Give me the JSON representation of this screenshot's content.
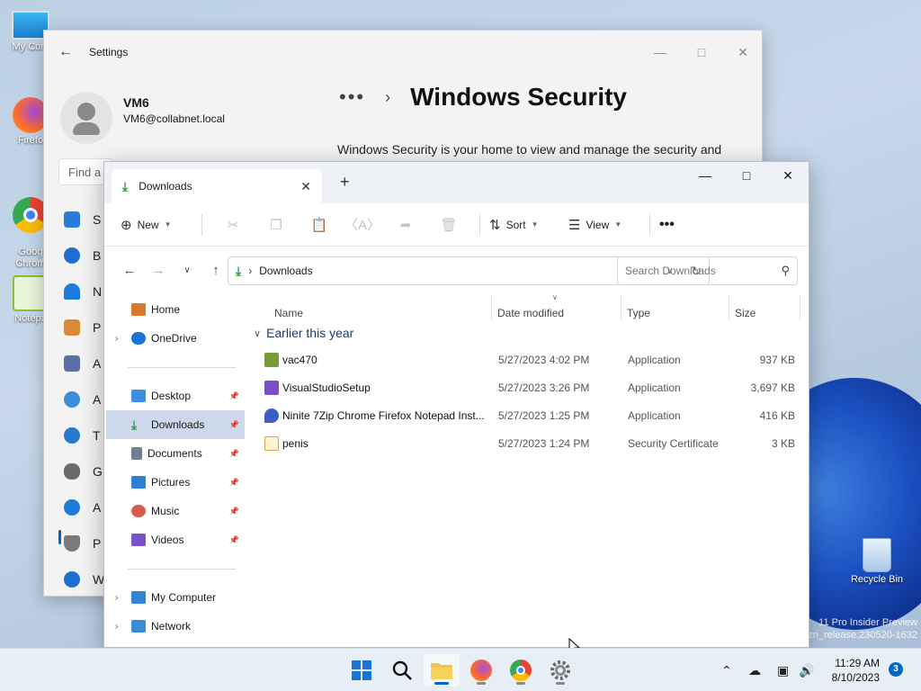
{
  "desktop": {
    "icons": [
      {
        "label": "My Com"
      },
      {
        "label": "Firefo"
      },
      {
        "label": "Goog\nChrom"
      },
      {
        "label": "Notepa"
      },
      {
        "label": "Recycle Bin"
      }
    ],
    "watermark_line1": "11 Pro Insider Preview",
    "watermark_line2": "zn_release.230520-1632"
  },
  "settings": {
    "title": "Settings",
    "back_icon": "back-arrow-icon",
    "user_name": "VM6",
    "user_email": "VM6@collabnet.local",
    "find_placeholder": "Find a",
    "breadcrumb_more": "•••",
    "page_title": "Windows Security",
    "description": "Windows Security is your home to view and manage the security and health of your device.",
    "nav": [
      {
        "label": "S",
        "color": "#2a7bd6"
      },
      {
        "label": "B",
        "color": "#1f6fd1"
      },
      {
        "label": "N",
        "color": "#1d7be0"
      },
      {
        "label": "P",
        "color": "#d88a36"
      },
      {
        "label": "A",
        "color": "#5a6fa8"
      },
      {
        "label": "A",
        "color": "#3a8fd8"
      },
      {
        "label": "T",
        "color": "#2a78c8"
      },
      {
        "label": "G",
        "color": "#6a6a6a"
      },
      {
        "label": "A",
        "color": "#1f7ad6"
      },
      {
        "label": "P",
        "color": "#7a7a7a"
      },
      {
        "label": "W",
        "color": "#1e6fd1"
      }
    ]
  },
  "explorer": {
    "tab_title": "Downloads",
    "commands": {
      "new": "New",
      "sort": "Sort",
      "view": "View",
      "more": "•••"
    },
    "address_path": "Downloads",
    "search_placeholder": "Search Downloads",
    "nav_items": [
      {
        "label": "Home",
        "icon": "home-icon",
        "color": "#d97a2b",
        "pinned": false,
        "expandable": false
      },
      {
        "label": "OneDrive",
        "icon": "cloud-icon",
        "color": "#1a73d8",
        "pinned": false,
        "expandable": true
      },
      {
        "label": "Desktop",
        "icon": "desktop-icon",
        "color": "#3a8ee6",
        "pinned": true,
        "expandable": false
      },
      {
        "label": "Downloads",
        "icon": "download-icon",
        "color": "#2e9e3e",
        "pinned": true,
        "expandable": false
      },
      {
        "label": "Documents",
        "icon": "document-icon",
        "color": "#6f7f95",
        "pinned": true,
        "expandable": false
      },
      {
        "label": "Pictures",
        "icon": "pictures-icon",
        "color": "#2c7fd6",
        "pinned": true,
        "expandable": false
      },
      {
        "label": "Music",
        "icon": "music-icon",
        "color": "#d85a4a",
        "pinned": true,
        "expandable": false
      },
      {
        "label": "Videos",
        "icon": "videos-icon",
        "color": "#7a4fd0",
        "pinned": true,
        "expandable": false
      },
      {
        "label": "My Computer",
        "icon": "computer-icon",
        "color": "#2f86d8",
        "pinned": false,
        "expandable": true
      },
      {
        "label": "Network",
        "icon": "network-icon",
        "color": "#3a8bd6",
        "pinned": false,
        "expandable": true
      }
    ],
    "columns": {
      "name": "Name",
      "date": "Date modified",
      "type": "Type",
      "size": "Size"
    },
    "group_label": "Earlier this year",
    "files": [
      {
        "name": "vac470",
        "date": "5/27/2023 4:02 PM",
        "type": "Application",
        "size": "937 KB",
        "icon": "app-icon",
        "color": "#7a9a3a"
      },
      {
        "name": "VisualStudioSetup",
        "date": "5/27/2023 3:26 PM",
        "type": "Application",
        "size": "3,697 KB",
        "icon": "visual-studio-icon",
        "color": "#7b4fc8"
      },
      {
        "name": "Ninite 7Zip Chrome Firefox Notepad Inst...",
        "date": "5/27/2023 1:25 PM",
        "type": "Application",
        "size": "416 KB",
        "icon": "ninite-icon",
        "color": "#3a5fc8"
      },
      {
        "name": "penis",
        "date": "5/27/2023 1:24 PM",
        "type": "Security Certificate",
        "size": "3 KB",
        "icon": "certificate-icon",
        "color": "#d9a84a"
      }
    ]
  },
  "taskbar": {
    "apps": [
      {
        "name": "start-button",
        "icon": "windows-logo-icon",
        "active": false
      },
      {
        "name": "search-button",
        "icon": "search-icon",
        "active": false
      },
      {
        "name": "file-explorer-button",
        "icon": "folder-icon",
        "active": true
      },
      {
        "name": "firefox-button",
        "icon": "firefox-icon",
        "active": false
      },
      {
        "name": "chrome-button",
        "icon": "chrome-icon",
        "active": false
      },
      {
        "name": "settings-button",
        "icon": "gear-icon",
        "active": false
      }
    ],
    "time": "11:29 AM",
    "date": "8/10/2023",
    "notification_count": "3"
  }
}
